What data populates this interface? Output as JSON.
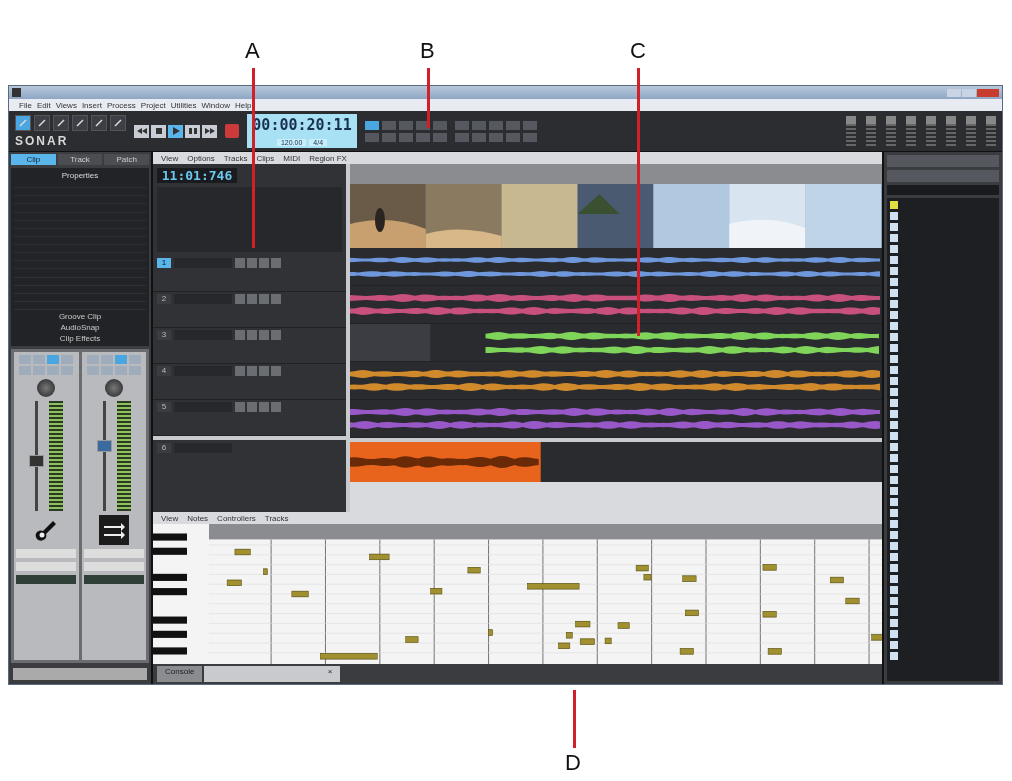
{
  "callouts": [
    {
      "label": "A"
    },
    {
      "label": "B"
    },
    {
      "label": "C"
    },
    {
      "label": "D"
    }
  ],
  "menu": [
    "File",
    "Edit",
    "Views",
    "Insert",
    "Process",
    "Project",
    "Utilities",
    "Window",
    "Help"
  ],
  "control_bar": {
    "logo": "SONAR",
    "time": "00:00:20:11",
    "tempo": "120.00",
    "meter": "4/4",
    "tools": [
      {
        "selected": true
      },
      {
        "selected": false
      },
      {
        "selected": false
      },
      {
        "selected": false
      },
      {
        "selected": false
      },
      {
        "selected": false
      }
    ],
    "transport": [
      {
        "kind": "rewind",
        "on": false
      },
      {
        "kind": "stop",
        "on": false
      },
      {
        "kind": "play",
        "on": true
      },
      {
        "kind": "pause",
        "on": false
      },
      {
        "kind": "forward",
        "on": false
      }
    ]
  },
  "inspector": {
    "tabs": [
      {
        "label": "Clip",
        "selected": true
      },
      {
        "label": "Track",
        "selected": false
      },
      {
        "label": "Patch",
        "selected": false
      }
    ],
    "properties_title": "Properties",
    "links": [
      "Groove Clip",
      "AudioSnap",
      "Clip Effects"
    ],
    "strips": [
      {
        "kind": "guitar",
        "level": 0.45
      },
      {
        "kind": "arrows",
        "level": 0.6
      }
    ]
  },
  "track_view": {
    "menus": [
      "View",
      "Options",
      "Tracks",
      "Clips",
      "MIDI",
      "Region FX"
    ],
    "now_time": "11:01:746",
    "tracks": [
      {
        "number": "1",
        "color": "#6f98dc",
        "selected": true
      },
      {
        "number": "2",
        "color": "#c8507c",
        "selected": false
      },
      {
        "number": "3",
        "color": "#7fd45a",
        "selected": false
      },
      {
        "number": "4",
        "color": "#d08a2c",
        "selected": false
      },
      {
        "number": "5",
        "color": "#9858c8",
        "selected": false
      }
    ],
    "bus": {
      "number": "6",
      "color": "#e8641c"
    }
  },
  "piano_roll": {
    "menus": [
      "View",
      "Notes",
      "Controllers",
      "Tracks"
    ]
  },
  "bottom_tabs": [
    {
      "label": "Console",
      "selected": false
    },
    {
      "label": "×",
      "selected": true
    }
  ]
}
